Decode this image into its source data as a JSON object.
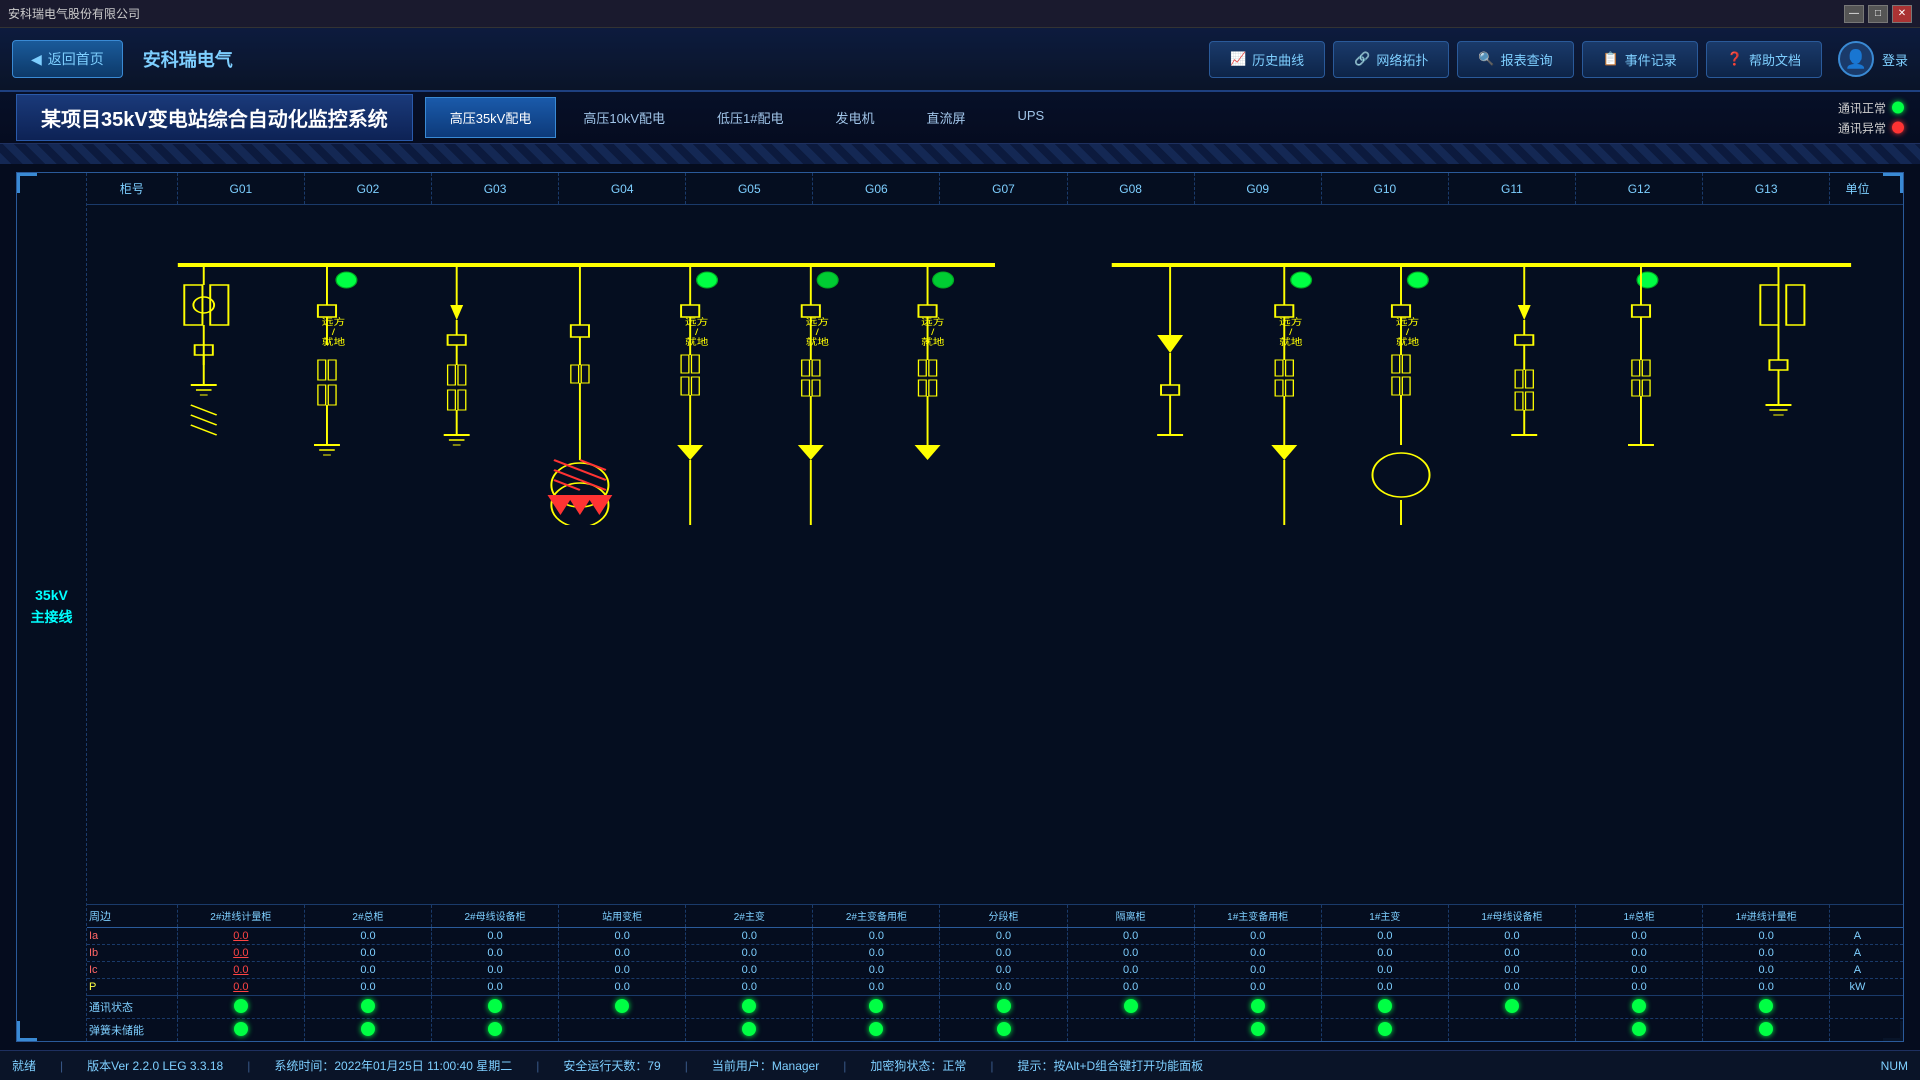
{
  "titleBar": {
    "title": "安科瑞电气股份有限公司",
    "controls": [
      "—",
      "□",
      "✕"
    ]
  },
  "header": {
    "backBtn": "返回首页",
    "companyName": "安科瑞电气",
    "navButtons": [
      {
        "label": "历史曲线",
        "icon": "chart-icon"
      },
      {
        "label": "网络拓扑",
        "icon": "network-icon"
      },
      {
        "label": "报表查询",
        "icon": "report-icon"
      },
      {
        "label": "事件记录",
        "icon": "event-icon"
      },
      {
        "label": "帮助文档",
        "icon": "help-icon"
      }
    ],
    "loginLabel": "登录"
  },
  "subHeader": {
    "systemTitle": "某项目35kV变电站综合自动化监控系统",
    "tabs": [
      {
        "label": "高压35kV配电",
        "active": true
      },
      {
        "label": "高压10kV配电",
        "active": false
      },
      {
        "label": "低压1#配电",
        "active": false
      },
      {
        "label": "发电机",
        "active": false
      },
      {
        "label": "直流屏",
        "active": false
      },
      {
        "label": "UPS",
        "active": false
      }
    ],
    "statusItems": [
      {
        "label": "通讯正常",
        "color": "green"
      },
      {
        "label": "通讯异常",
        "color": "red"
      }
    ]
  },
  "diagram": {
    "leftLabel": "35kV\n主接线",
    "columns": [
      {
        "id": "G00",
        "label": "柜号"
      },
      {
        "id": "G01",
        "label": "G01"
      },
      {
        "id": "G02",
        "label": "G02"
      },
      {
        "id": "G03",
        "label": "G03"
      },
      {
        "id": "G04",
        "label": "G04"
      },
      {
        "id": "G05",
        "label": "G05"
      },
      {
        "id": "G06",
        "label": "G06"
      },
      {
        "id": "G07",
        "label": "G07"
      },
      {
        "id": "G08",
        "label": "G08"
      },
      {
        "id": "G09",
        "label": "G09"
      },
      {
        "id": "G10",
        "label": "G10"
      },
      {
        "id": "G11",
        "label": "G11"
      },
      {
        "id": "G12",
        "label": "G12"
      },
      {
        "id": "G13",
        "label": "G13"
      },
      {
        "id": "unit",
        "label": "单位"
      }
    ],
    "descriptions": [
      "",
      "2#进线计量柜",
      "2#总柜",
      "2#母线设备柜",
      "站用变柜",
      "2#主变",
      "2#主变备用柜",
      "分段柜",
      "隔离柜",
      "1#主变备用柜",
      "1#主变",
      "1#母线设备柜",
      "1#总柜",
      "1#进线计量柜",
      ""
    ],
    "params": [
      "Ia",
      "Ib",
      "Ic",
      "P"
    ],
    "units": [
      "A",
      "A",
      "A",
      "kW"
    ],
    "dataRows": [
      {
        "label": "Ia",
        "values": [
          "0.0",
          "0.0",
          "0.0",
          "0.0",
          "0.0",
          "0.0",
          "0.0",
          "0.0",
          "0.0",
          "0.0",
          "0.0",
          "0.0",
          "0.0"
        ],
        "highlight": [
          true,
          false,
          false,
          false,
          false,
          false,
          false,
          false,
          false,
          false,
          false,
          false,
          false
        ],
        "unit": "A"
      },
      {
        "label": "Ib",
        "values": [
          "0.0",
          "0.0",
          "0.0",
          "0.0",
          "0.0",
          "0.0",
          "0.0",
          "0.0",
          "0.0",
          "0.0",
          "0.0",
          "0.0",
          "0.0"
        ],
        "highlight": [
          true,
          false,
          false,
          false,
          false,
          false,
          false,
          false,
          false,
          false,
          false,
          false,
          false
        ],
        "unit": "A"
      },
      {
        "label": "Ic",
        "values": [
          "0.0",
          "0.0",
          "0.0",
          "0.0",
          "0.0",
          "0.0",
          "0.0",
          "0.0",
          "0.0",
          "0.0",
          "0.0",
          "0.0",
          "0.0"
        ],
        "highlight": [
          true,
          false,
          false,
          false,
          false,
          false,
          false,
          false,
          false,
          false,
          false,
          false,
          false
        ],
        "unit": "A"
      },
      {
        "label": "P",
        "values": [
          "0.0",
          "0.0",
          "0.0",
          "0.0",
          "0.0",
          "0.0",
          "0.0",
          "0.0",
          "0.0",
          "0.0",
          "0.0",
          "0.0",
          "0.0"
        ],
        "highlight": [
          true,
          false,
          false,
          false,
          false,
          false,
          false,
          false,
          false,
          false,
          false,
          false,
          false
        ],
        "unit": "kW"
      }
    ],
    "commStatus": {
      "label1": "通讯状态",
      "label2": "弹簧未储能"
    }
  },
  "statusBar": {
    "readyLabel": "就绪",
    "version": "版本Ver 2.2.0 LEG 3.3.18",
    "sysTime": "系统时间：2022年01月25日  11:00:40  星期二",
    "safetyDays": "安全运行天数：79",
    "currentUser": "当前用户：Manager",
    "encryptStatus": "加密狗状态：正常",
    "hint": "提示：按Alt+D组合键打开功能面板",
    "numLabel": "NUM"
  },
  "colors": {
    "busBar": "#ffff00",
    "activeGreen": "#00ff44",
    "activeRed": "#ff3333",
    "cyan": "#00ffff",
    "accent": "#3a8ad4",
    "bgDark": "#050c1e",
    "highlight": "#ff4444"
  }
}
